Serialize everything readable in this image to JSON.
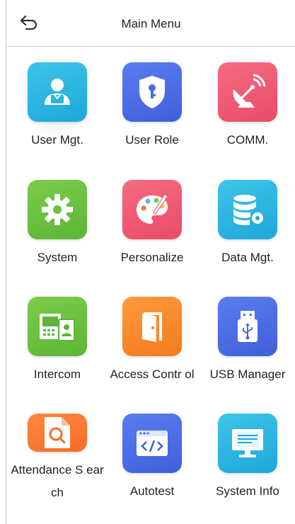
{
  "header": {
    "title": "Main Menu",
    "back_icon": "back-arrow-icon"
  },
  "menu": [
    {
      "label": "User Mgt.",
      "icon": "user-icon",
      "color": "#3cc4e8",
      "color2": "#1fa7dc",
      "selected": true
    },
    {
      "label": "User Role",
      "icon": "shield-key-icon",
      "color": "#5b7df0",
      "color2": "#3f5fd9"
    },
    {
      "label": "COMM.",
      "icon": "satellite-dish-icon",
      "color": "#f56b83",
      "color2": "#e94b66"
    },
    {
      "label": "System",
      "icon": "gear-icon",
      "color": "#7ccc4a",
      "color2": "#5cb536"
    },
    {
      "label": "Personalize",
      "icon": "palette-icon",
      "color": "#f56b83",
      "color2": "#e94b66"
    },
    {
      "label": "Data Mgt.",
      "icon": "database-icon",
      "color": "#3cc4e8",
      "color2": "#1fa7dc"
    },
    {
      "label": "Intercom",
      "icon": "intercom-icon",
      "color": "#7ccc4a",
      "color2": "#5cb536"
    },
    {
      "label": "Access Contr ol",
      "icon": "door-icon",
      "color": "#ff9a3c",
      "color2": "#f47a1e"
    },
    {
      "label": "USB Manager",
      "icon": "usb-icon",
      "color": "#5b7df0",
      "color2": "#3f5fd9"
    },
    {
      "label": "Attendance S earch",
      "icon": "search-document-icon",
      "color": "#ff8a3c",
      "color2": "#f56b2a"
    },
    {
      "label": "Autotest",
      "icon": "code-window-icon",
      "color": "#5b7df0",
      "color2": "#3f5fd9"
    },
    {
      "label": "System Info",
      "icon": "monitor-icon",
      "color": "#3cc4e8",
      "color2": "#1fa7dc"
    }
  ]
}
